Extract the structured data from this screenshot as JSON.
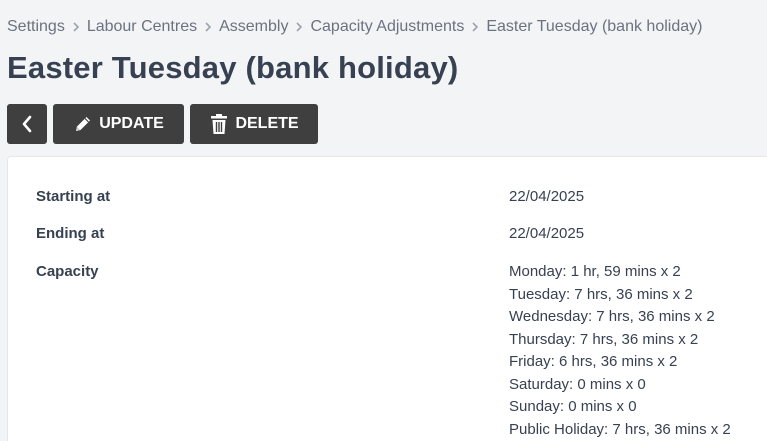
{
  "breadcrumb": [
    {
      "label": "Settings"
    },
    {
      "label": "Labour Centres"
    },
    {
      "label": "Assembly"
    },
    {
      "label": "Capacity Adjustments"
    },
    {
      "label": "Easter Tuesday (bank holiday)"
    }
  ],
  "page_title": "Easter Tuesday (bank holiday)",
  "toolbar": {
    "back_icon": "chevron-left-icon",
    "update_label": "UPDATE",
    "update_icon": "pencil-icon",
    "delete_label": "DELETE",
    "delete_icon": "trash-icon"
  },
  "details": {
    "starting_label": "Starting at",
    "starting_value": "22/04/2025",
    "ending_label": "Ending at",
    "ending_value": "22/04/2025",
    "capacity_label": "Capacity",
    "capacity": [
      "Monday: 1 hr, 59 mins x 2",
      "Tuesday: 7 hrs, 36 mins x 2",
      "Wednesday: 7 hrs, 36 mins x 2",
      "Thursday: 7 hrs, 36 mins x 2",
      "Friday: 6 hrs, 36 mins x 2",
      "Saturday: 0 mins x 0",
      "Sunday: 0 mins x 0",
      "Public Holiday: 7 hrs, 36 mins x 2"
    ]
  },
  "colors": {
    "background": "#f3f4f6",
    "button": "#3f3f3f",
    "text": "#374151",
    "muted": "#6b7280"
  }
}
